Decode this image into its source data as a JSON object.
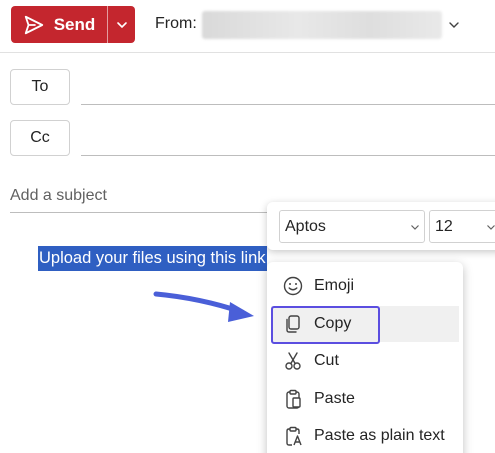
{
  "toolbar": {
    "send_label": "Send",
    "from_label": "From:",
    "from_value": ""
  },
  "recipients": {
    "to_label": "To",
    "cc_label": "Cc"
  },
  "subject": {
    "placeholder": "Add a subject",
    "value": ""
  },
  "body": {
    "selected_text": "Upload your files using this link"
  },
  "format_bar": {
    "font": "Aptos",
    "size": "12"
  },
  "context_menu": {
    "items": [
      {
        "label": "Emoji",
        "icon": "emoji-icon"
      },
      {
        "label": "Copy",
        "icon": "copy-icon",
        "highlighted": true
      },
      {
        "label": "Cut",
        "icon": "scissors-icon"
      },
      {
        "label": "Paste",
        "icon": "clipboard-icon"
      },
      {
        "label": "Paste as plain text",
        "icon": "paste-text-icon"
      }
    ]
  },
  "colors": {
    "send_button": "#c4262e",
    "selection": "#2f5fc2",
    "highlight_outline": "#5b4ee0",
    "annotation_arrow": "#4a5fd8"
  }
}
